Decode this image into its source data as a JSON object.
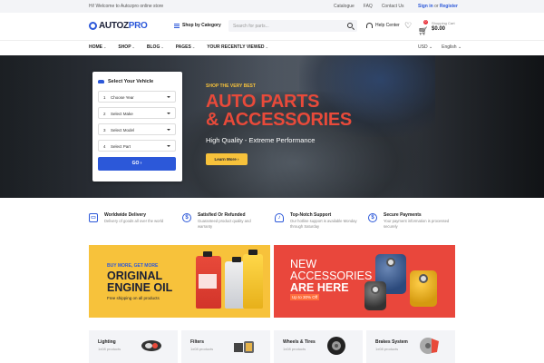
{
  "topbar": {
    "welcome": "Hi! Welcome to Autozpro online store",
    "links": [
      "Catalogue",
      "FAQ",
      "Contact Us"
    ],
    "sign_in": "Sign in",
    "or": "or",
    "register": "Register"
  },
  "header": {
    "logo_auto": "AUTOZ",
    "logo_pro": "PRO",
    "shop_by_category": "Shop by Category",
    "search_placeholder": "Search for parts...",
    "help_label": "Help Center",
    "cart_label": "Shopping Cart",
    "cart_total": "$0.00",
    "cart_count": "0"
  },
  "nav": {
    "items": [
      {
        "label": "Home",
        "has_dropdown": true
      },
      {
        "label": "Shop",
        "has_dropdown": true
      },
      {
        "label": "Blog",
        "has_dropdown": true
      },
      {
        "label": "Pages",
        "has_dropdown": true
      },
      {
        "label": "Your Recently Viewed",
        "has_dropdown": true
      }
    ],
    "currency": "USD",
    "language": "English"
  },
  "vehicle_selector": {
    "title": "Select Your Vehicle",
    "fields": [
      {
        "num": "1",
        "label": "Choose Year"
      },
      {
        "num": "2",
        "label": "Select Make"
      },
      {
        "num": "3",
        "label": "Select Model"
      },
      {
        "num": "4",
        "label": "Select Part"
      }
    ],
    "go_label": "GO"
  },
  "hero": {
    "pre": "Shop the very best",
    "line1": "Auto Parts",
    "line2": "& Accessories",
    "subtitle": "High Quality - Extreme Performance",
    "cta": "Learn More"
  },
  "features": [
    {
      "title": "Worldwide Delivery",
      "desc": "Delivery of goods all over the world",
      "icon": "truck-icon"
    },
    {
      "title": "Satisfied Or Refunded",
      "desc": "Guaranteed product quality and warranty",
      "icon": "refund-icon"
    },
    {
      "title": "Top-Notch Support",
      "desc": "Our hotline support is available Monday through Saturday",
      "icon": "support-icon"
    },
    {
      "title": "Secure Payments",
      "desc": "Your payment information is processed securely",
      "icon": "secure-payment-icon"
    }
  ],
  "banners": [
    {
      "pre": "Buy more, Get more",
      "line1": "Original",
      "line2": "Engine Oil",
      "sub": "Free shipping on all products"
    },
    {
      "pre": "",
      "line1": "New",
      "line2": "Accessories",
      "line3": "Are Here",
      "sub": "Up to 30% Off"
    }
  ],
  "categories": [
    {
      "name": "Lighting",
      "count": "1x08 products"
    },
    {
      "name": "Filters",
      "count": "1x08 products"
    },
    {
      "name": "Wheels & Tires",
      "count": "1x08 products"
    },
    {
      "name": "Brakes System",
      "count": "1x08 products"
    }
  ],
  "colors": {
    "brand_blue": "#2c58d9",
    "accent_yellow": "#f7c23b",
    "accent_red": "#e84a3a"
  }
}
